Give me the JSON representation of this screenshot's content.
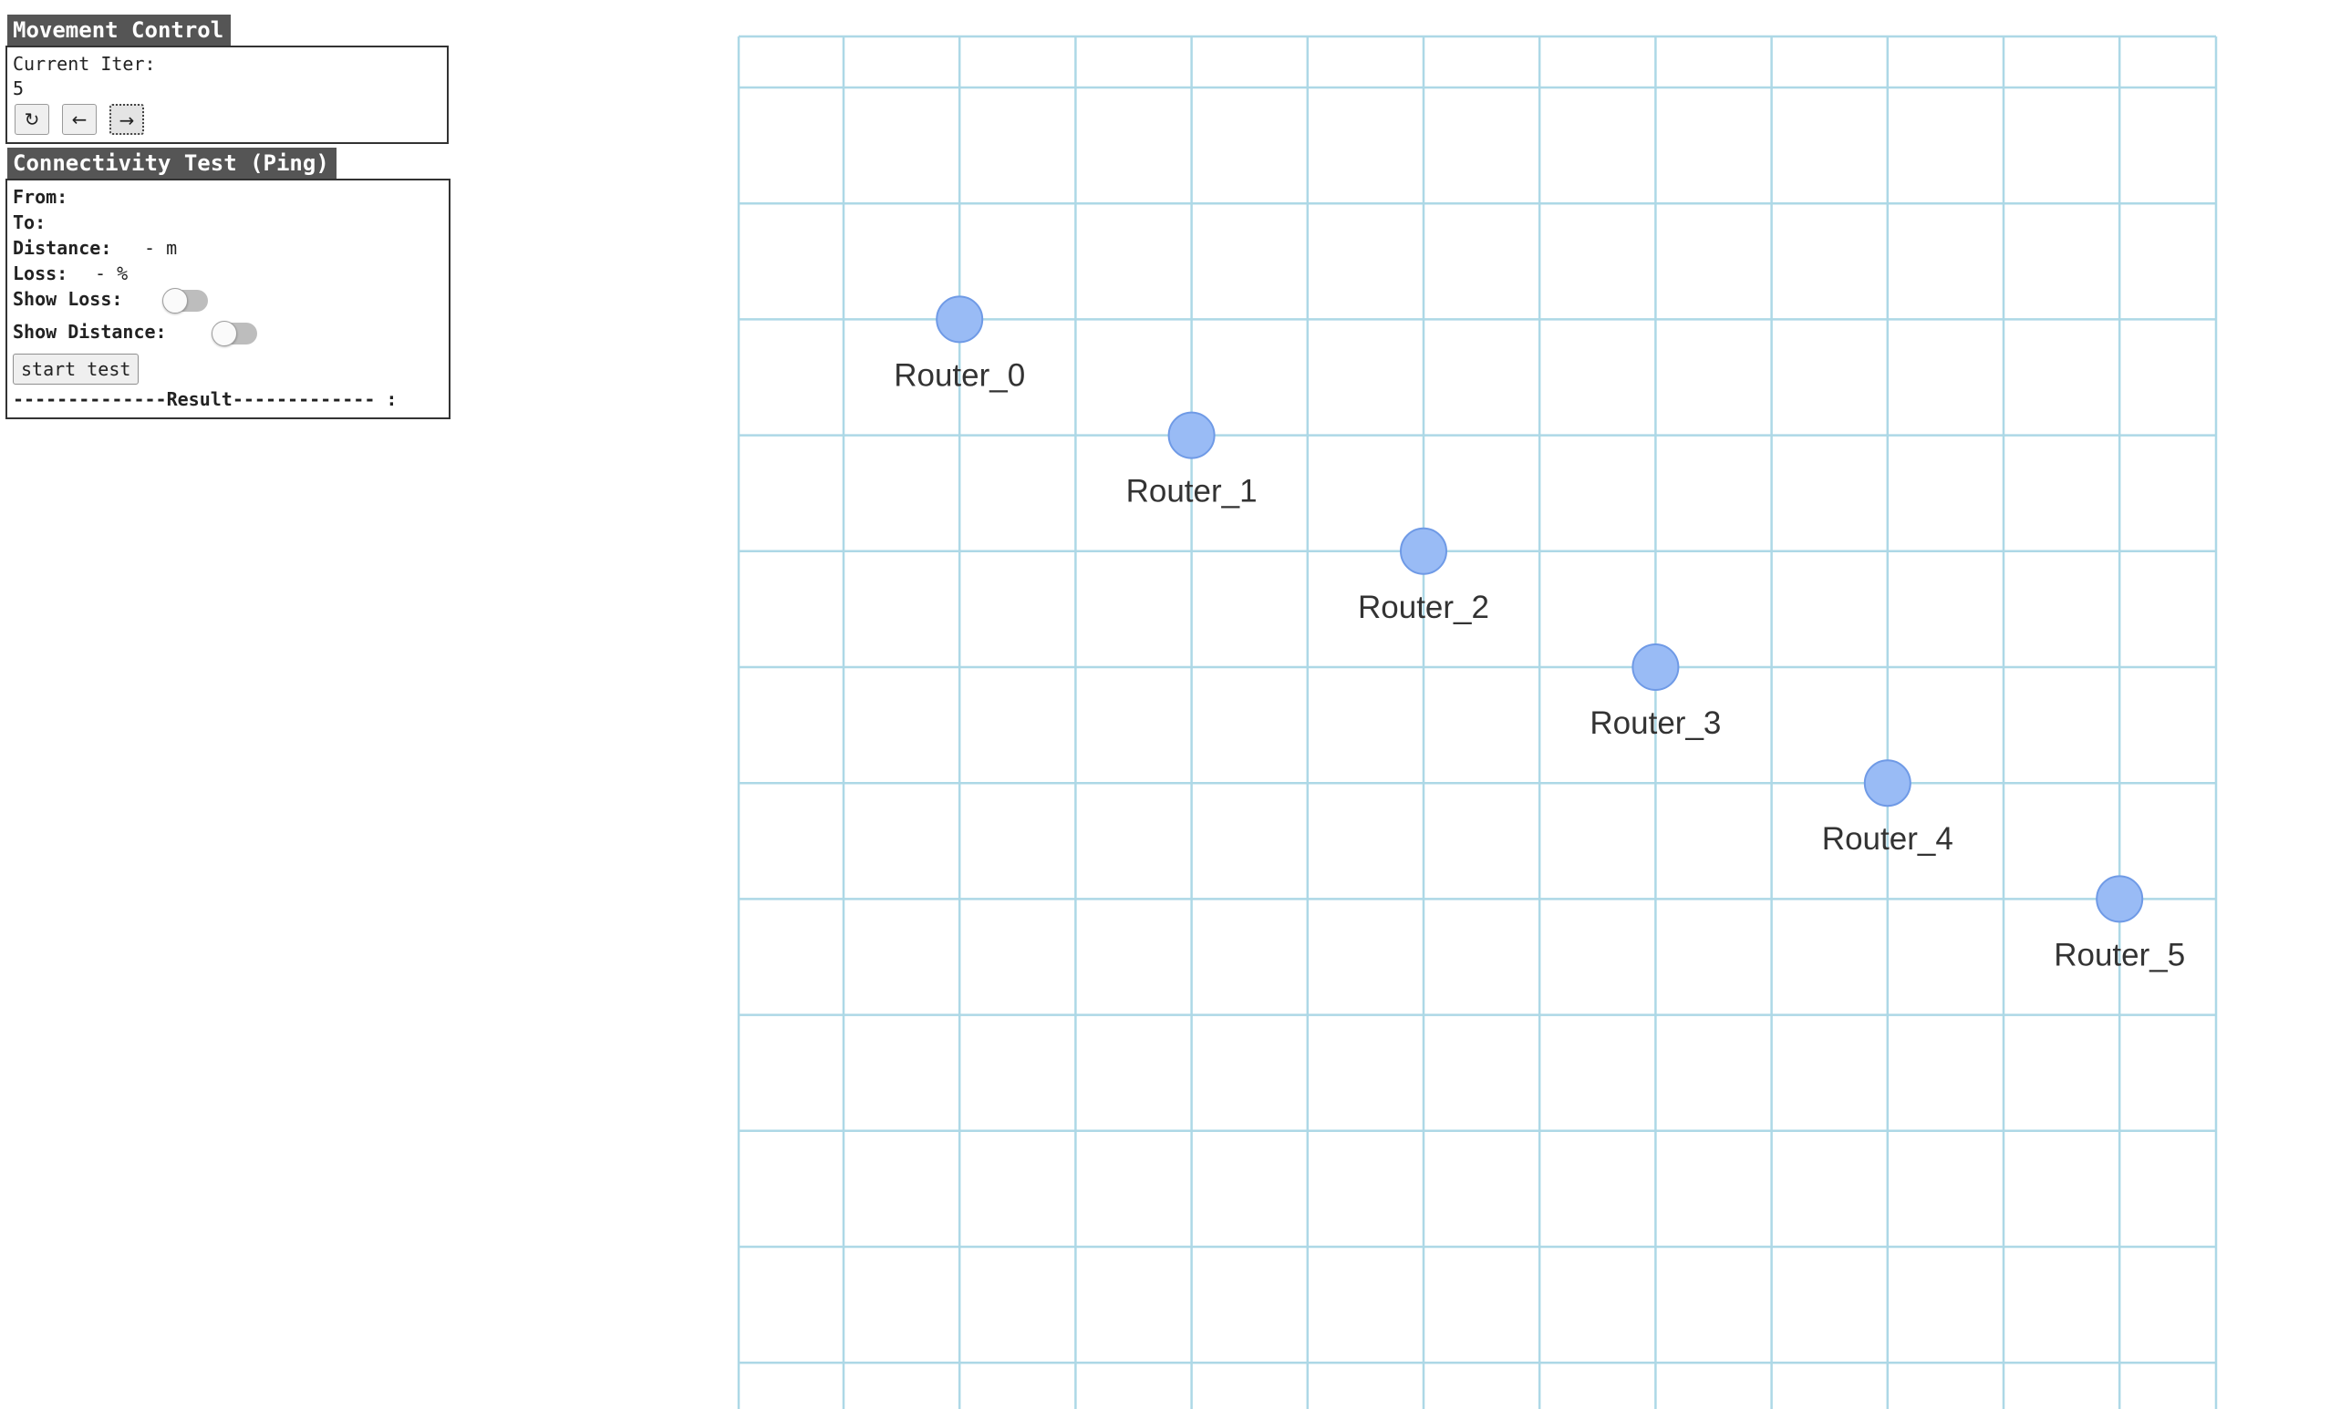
{
  "movement_control": {
    "title": "Movement Control",
    "current_iter_label": "Current Iter:",
    "current_iter_value": "5",
    "buttons": {
      "reset_icon": "refresh-icon",
      "prev_icon": "arrow-left-icon",
      "next_icon": "arrow-right-icon",
      "reset_glyph": "↻",
      "prev_glyph": "←",
      "next_glyph": "→"
    }
  },
  "connectivity_test": {
    "title": "Connectivity Test (Ping)",
    "from_label": "From:",
    "from_value": "",
    "to_label": "To:",
    "to_value": "",
    "distance_label": "Distance:",
    "distance_value": "- m",
    "loss_label": "Loss:",
    "loss_value": "- %",
    "show_loss_label": "Show Loss:",
    "show_loss_on": false,
    "show_distance_label": "Show Distance:",
    "show_distance_on": false,
    "start_button": "start test",
    "result_line": "--------------Result------------- :"
  },
  "map": {
    "grid_color": "#add8e6",
    "node_fill": "#99bbf5",
    "node_stroke": "#6f9ae6",
    "label_color": "#333333",
    "routers": [
      {
        "name": "Router_0",
        "col": 2,
        "row": 3
      },
      {
        "name": "Router_1",
        "col": 4,
        "row": 4
      },
      {
        "name": "Router_2",
        "col": 6,
        "row": 5
      },
      {
        "name": "Router_3",
        "col": 8,
        "row": 6
      },
      {
        "name": "Router_4",
        "col": 10,
        "row": 7
      },
      {
        "name": "Router_5",
        "col": 12,
        "row": 8
      }
    ]
  }
}
